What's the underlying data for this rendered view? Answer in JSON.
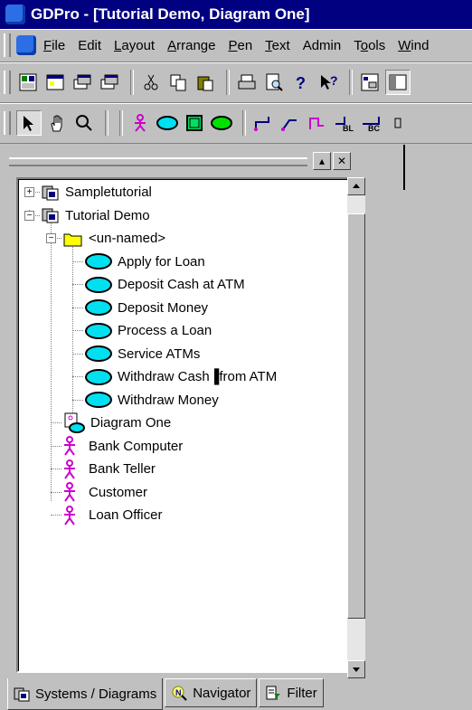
{
  "window": {
    "title": "GDPro - [Tutorial Demo, Diagram One]"
  },
  "menu": {
    "items": [
      {
        "label": "File",
        "accel": "F"
      },
      {
        "label": "Edit",
        "accel": ""
      },
      {
        "label": "Layout",
        "accel": "L"
      },
      {
        "label": "Arrange",
        "accel": "A"
      },
      {
        "label": "Pen",
        "accel": "P"
      },
      {
        "label": "Text",
        "accel": "T"
      },
      {
        "label": "Admin",
        "accel": ""
      },
      {
        "label": "Tools",
        "accel": "o"
      },
      {
        "label": "Wind",
        "accel": "W"
      }
    ]
  },
  "toolbar1": {
    "buttons": [
      "new-icon",
      "open-icon",
      "copy-window-icon",
      "print-window-icon",
      "cut-icon",
      "copy-icon",
      "paste-icon",
      "print-icon",
      "print-preview-icon",
      "help-icon",
      "context-help-icon",
      "tree-icon",
      "panel-icon"
    ]
  },
  "toolbar2": {
    "buttons": [
      "select-arrow-icon",
      "hand-icon",
      "zoom-icon",
      "actor-tool-icon",
      "use-case-tool-icon",
      "system-tool-icon",
      "ellipse-tool-icon",
      "relationship-tool-icon",
      "relationship-tool-2-icon",
      "relationship-tool-3-icon",
      "bl-tool-icon",
      "bc-tool-icon",
      "more-tool-icon"
    ]
  },
  "tree": {
    "items": [
      {
        "label": "Sampletutorial",
        "icon": "system-icon",
        "level": 0,
        "expander": "+"
      },
      {
        "label": "Tutorial Demo",
        "icon": "system-icon",
        "level": 0,
        "expander": "-"
      },
      {
        "label": "<un-named>",
        "icon": "folder-icon",
        "level": 1,
        "expander": "-"
      },
      {
        "label": "Apply for Loan",
        "icon": "use-case-icon",
        "level": 2
      },
      {
        "label": "Deposit Cash at ATM",
        "icon": "use-case-icon",
        "level": 2
      },
      {
        "label": "Deposit Money",
        "icon": "use-case-icon",
        "level": 2
      },
      {
        "label": "Process a Loan",
        "icon": "use-case-icon",
        "level": 2
      },
      {
        "label": "Service ATMs",
        "icon": "use-case-icon",
        "level": 2
      },
      {
        "label": "Withdraw Cash▐from ATM",
        "icon": "use-case-icon",
        "level": 2
      },
      {
        "label": "Withdraw Money",
        "icon": "use-case-icon",
        "level": 2
      },
      {
        "label": "Diagram One",
        "icon": "diagram-icon",
        "level": 1
      },
      {
        "label": "Bank Computer",
        "icon": "actor-icon",
        "level": 1
      },
      {
        "label": "Bank Teller",
        "icon": "actor-icon",
        "level": 1
      },
      {
        "label": "Customer",
        "icon": "actor-icon",
        "level": 1
      },
      {
        "label": "Loan Officer",
        "icon": "actor-icon",
        "level": 1
      }
    ]
  },
  "tabs": [
    {
      "label": "Systems / Diagrams",
      "icon": "system-icon",
      "active": true
    },
    {
      "label": "Navigator",
      "icon": "navigator-icon",
      "active": false
    },
    {
      "label": "Filter",
      "icon": "filter-icon",
      "active": false
    }
  ],
  "colors": {
    "title_bar": "#000080",
    "use_case": "#00e0f0",
    "actor": "#cc00cc",
    "folder": "#ffff00"
  }
}
